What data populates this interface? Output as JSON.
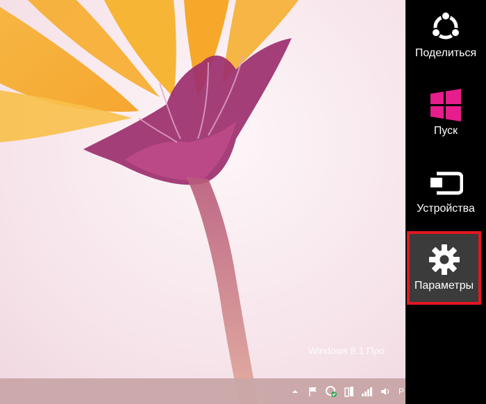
{
  "desktop": {
    "watermark": "Windows 8.1 Προ"
  },
  "taskbar": {
    "tray": {
      "icons": [
        "show-hidden-icons-arrow-icon",
        "action-center-flag-icon",
        "network-sync-icon",
        "power-icon",
        "signal-bars-icon",
        "volume-icon"
      ],
      "language_indicator": "Р"
    }
  },
  "charms": {
    "share": {
      "label": "Поделиться",
      "icon": "share-icon"
    },
    "start": {
      "label": "Пуск",
      "icon": "windows-logo-icon",
      "color": "#e61d8c"
    },
    "devices": {
      "label": "Устройства",
      "icon": "devices-icon"
    },
    "settings": {
      "label": "Параметры",
      "icon": "gear-icon",
      "highlight_color": "#e4161f"
    }
  }
}
